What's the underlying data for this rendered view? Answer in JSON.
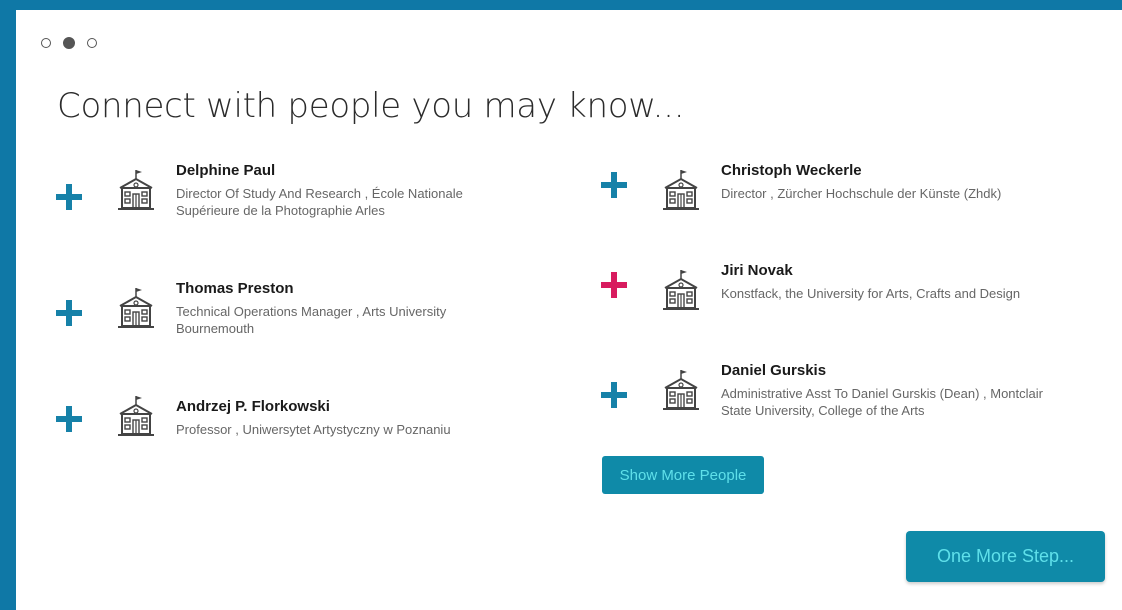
{
  "title": "Connect with people you may know...",
  "steps": {
    "count": 3,
    "active_index": 1
  },
  "colors": {
    "accent": "#0f8aa8",
    "add_default": "#1681a8",
    "add_hover": "#d81b5f",
    "button_text": "#5fe0ea"
  },
  "people": [
    {
      "name": "Delphine Paul",
      "desc": "Director Of Study And Research , École Nationale Supérieure de la Photographie Arles",
      "icon": "school-building-icon",
      "add_color": "blue"
    },
    {
      "name": "Thomas Preston",
      "desc": "Technical Operations Manager , Arts University Bournemouth",
      "icon": "school-building-icon",
      "add_color": "blue"
    },
    {
      "name": "Andrzej P. Florkowski",
      "desc": "Professor , Uniwersytet Artystyczny w Poznaniu",
      "icon": "school-building-icon",
      "add_color": "blue"
    },
    {
      "name": "Christoph Weckerle",
      "desc": "Director , Zürcher Hochschule der Künste (Zhdk)",
      "icon": "school-building-icon",
      "add_color": "blue"
    },
    {
      "name": "Jiri Novak",
      "desc": "Konstfack, the University for Arts, Crafts and Design",
      "icon": "school-building-icon",
      "add_color": "pink"
    },
    {
      "name": "Daniel Gurskis",
      "desc": "Administrative Asst To Daniel Gurskis (Dean) , Montclair State University, College of the Arts",
      "icon": "school-building-icon",
      "add_color": "blue"
    }
  ],
  "buttons": {
    "show_more": "Show More People",
    "next_step": "One More Step..."
  }
}
